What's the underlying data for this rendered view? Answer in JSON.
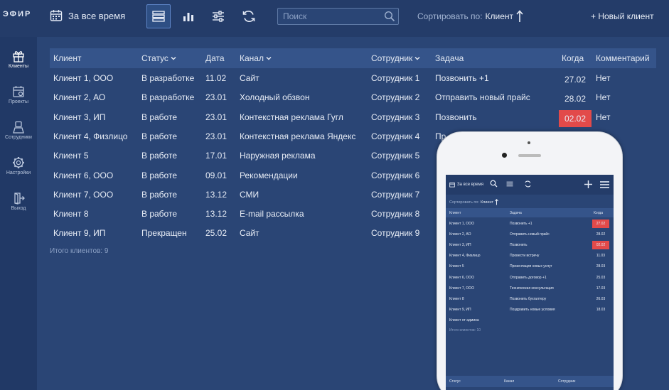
{
  "app": {
    "logo_text": "ЭФИР"
  },
  "toolbar": {
    "period_label": "За все время",
    "search_placeholder": "Поиск",
    "sort_label": "Сортировать по:",
    "sort_value": "Клиент",
    "new_client_label": "+ Новый клиент"
  },
  "sidebar": {
    "items": [
      {
        "label": "Клиенты",
        "icon": "gift-icon"
      },
      {
        "label": "Проекты",
        "icon": "calendar-icon"
      },
      {
        "label": "Сотрудники",
        "icon": "user-icon"
      },
      {
        "label": "Настройки",
        "icon": "gear-icon"
      },
      {
        "label": "Выход",
        "icon": "exit-icon"
      }
    ]
  },
  "table": {
    "headers": {
      "client": "Клиент",
      "status": "Статус",
      "date": "Дата",
      "channel": "Канал",
      "employee": "Сотрудник",
      "task": "Задача",
      "when": "Когда",
      "comment": "Комментарий"
    },
    "rows": [
      {
        "client": "Клиент 1, ООО",
        "status": "В разработке",
        "date": "11.02",
        "channel": "Сайт",
        "employee": "Сотрудник 1",
        "task": "Позвонить +1",
        "when": "27.02",
        "comment": "Нет",
        "overdue": false
      },
      {
        "client": "Клиент 2, АО",
        "status": "В разработке",
        "date": "23.01",
        "channel": "Холодный обзвон",
        "employee": "Сотрудник 2",
        "task": "Отправить новый прайс",
        "when": "28.02",
        "comment": "Нет",
        "overdue": false
      },
      {
        "client": "Клиент 3, ИП",
        "status": "В работе",
        "date": "23.01",
        "channel": "Контекстная реклама Гугл",
        "employee": "Сотрудник 3",
        "task": "Позвонить",
        "when": "02.02",
        "comment": "Нет",
        "overdue": true
      },
      {
        "client": "Клиент 4, Физлицо",
        "status": "В работе",
        "date": "23.01",
        "channel": "Контекстная реклама Яндекс",
        "employee": "Сотрудник 4",
        "task": "Пр",
        "when": "",
        "comment": "",
        "overdue": false
      },
      {
        "client": "Клиент 5",
        "status": "В работе",
        "date": "17.01",
        "channel": "Наружная реклама",
        "employee": "Сотрудник 5",
        "task": "",
        "when": "",
        "comment": "",
        "overdue": false
      },
      {
        "client": "Клиент 6, ООО",
        "status": "В работе",
        "date": "09.01",
        "channel": "Рекомендации",
        "employee": "Сотрудник 6",
        "task": "",
        "when": "",
        "comment": "",
        "overdue": false
      },
      {
        "client": "Клиент 7, ООО",
        "status": "В работе",
        "date": "13.12",
        "channel": "СМИ",
        "employee": "Сотрудник 7",
        "task": "",
        "when": "",
        "comment": "",
        "overdue": false
      },
      {
        "client": "Клиент 8",
        "status": "В работе",
        "date": "13.12",
        "channel": "E-mail рассылка",
        "employee": "Сотрудник 8",
        "task": "",
        "when": "",
        "comment": "",
        "overdue": false
      },
      {
        "client": "Клиент 9, ИП",
        "status": "Прекращен",
        "date": "25.02",
        "channel": "Сайт",
        "employee": "Сотрудник 9",
        "task": "",
        "when": "",
        "comment": "",
        "overdue": false
      }
    ],
    "total": "Итого клиентов: 9"
  },
  "mobile": {
    "period_label": "За все время",
    "sort_label": "Сортировать по:",
    "sort_value": "Клиент",
    "headers": {
      "client": "Клиент",
      "task": "Задача",
      "when": "Когда"
    },
    "rows": [
      {
        "client": "Клиент 1, ООО",
        "task": "Позвонить +1",
        "when": "27.02",
        "overdue": true
      },
      {
        "client": "Клиент 2, АО",
        "task": "Отправить новый прайс",
        "when": "28.02",
        "overdue": false
      },
      {
        "client": "Клиент 3, ИП",
        "task": "Позвонить",
        "when": "02.02",
        "overdue": true
      },
      {
        "client": "Клиент 4, Физлицо",
        "task": "Провести встречу",
        "when": "11.03",
        "overdue": false
      },
      {
        "client": "Клиент 5",
        "task": "Презентация новых услуг",
        "when": "28.03",
        "overdue": false
      },
      {
        "client": "Клиент 6, ООО",
        "task": "Отправить договор +1",
        "when": "25.03",
        "overdue": false
      },
      {
        "client": "Клиент 7, ООО",
        "task": "Техническая консультация",
        "when": "17.03",
        "overdue": false
      },
      {
        "client": "Клиент 8",
        "task": "Позвонить бухгалтеру",
        "when": "26.03",
        "overdue": false
      },
      {
        "client": "Клиент 9, ИП",
        "task": "Поздравить новые условия",
        "when": "18.03",
        "overdue": false
      },
      {
        "client": "Клиент от админа",
        "task": "",
        "when": "",
        "overdue": false
      }
    ],
    "total": "Итого клиентов: 10",
    "footer": {
      "status": "Статус",
      "channel": "Канал",
      "employee": "Сотрудник"
    }
  },
  "colors": {
    "background": "#2a4575",
    "topbar": "#243c69",
    "sidebar": "#213966",
    "header_row": "#35548a",
    "overdue": "#e24a4a"
  }
}
